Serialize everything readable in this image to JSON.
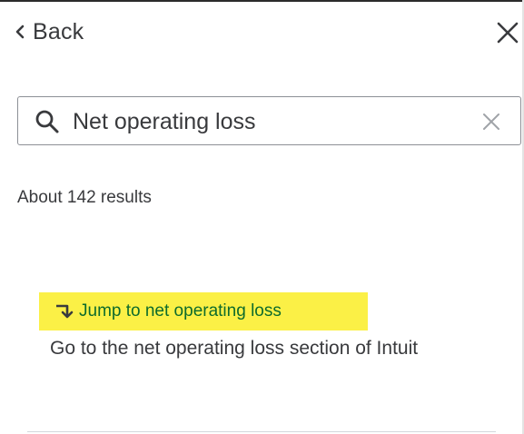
{
  "header": {
    "back_label": "Back",
    "back_icon": "chevron-left-icon",
    "close_icon": "close-icon"
  },
  "search": {
    "value": "Net operating loss",
    "placeholder": "",
    "search_icon": "search-icon",
    "clear_icon": "clear-icon"
  },
  "results": {
    "count_text": "About 142 results",
    "items": [
      {
        "link_label": "Jump to net operating loss",
        "link_icon": "jump-arrow-icon",
        "description": "Go to the net operating loss section of Intuit"
      }
    ]
  },
  "colors": {
    "highlight": "#fbf046",
    "link_text": "#0d6b2c",
    "body_text": "#393a3d"
  }
}
